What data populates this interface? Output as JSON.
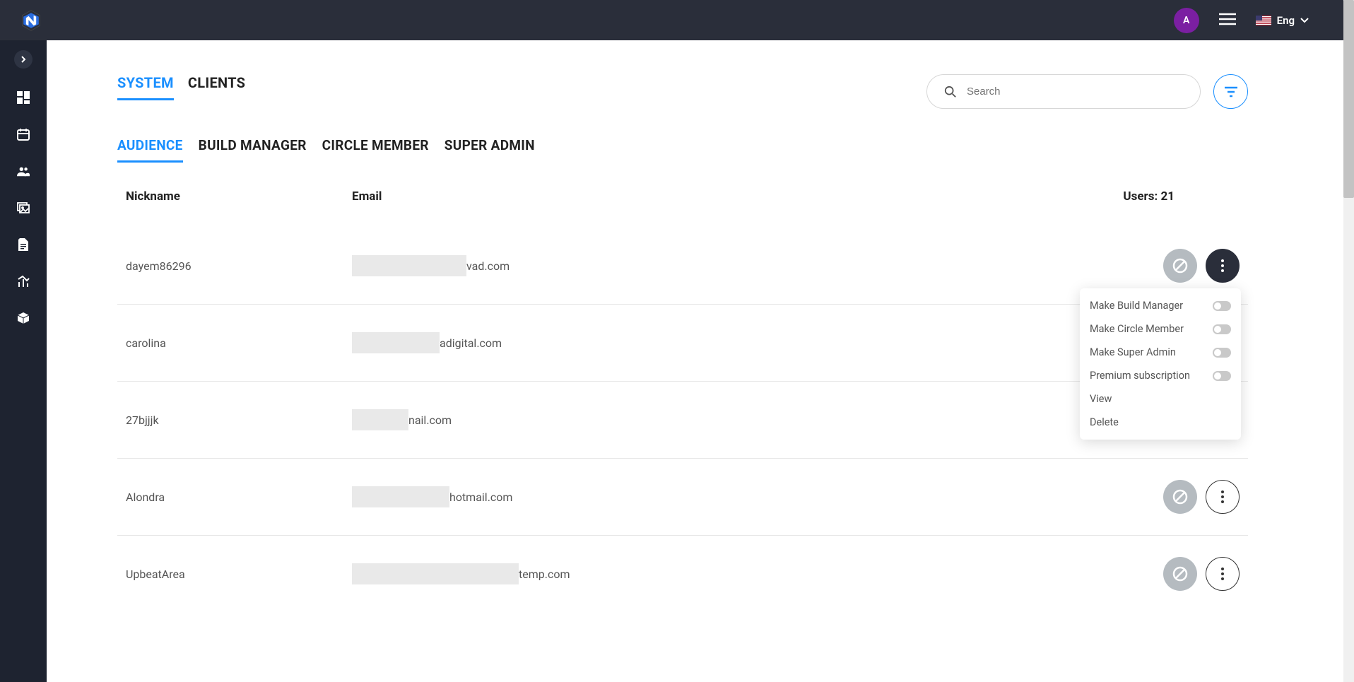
{
  "header": {
    "avatar_initial": "A",
    "language": "Eng"
  },
  "tabs": {
    "primary": [
      {
        "label": "SYSTEM",
        "active": true
      },
      {
        "label": "CLIENTS",
        "active": false
      }
    ],
    "secondary": [
      {
        "label": "AUDIENCE",
        "active": true
      },
      {
        "label": "BUILD MANAGER",
        "active": false
      },
      {
        "label": "CIRCLE MEMBER",
        "active": false
      },
      {
        "label": "SUPER ADMIN",
        "active": false
      }
    ]
  },
  "search": {
    "placeholder": "Search"
  },
  "table": {
    "col_nickname": "Nickname",
    "col_email": "Email",
    "users_label": "Users: 21"
  },
  "users": [
    {
      "nickname": "dayem86296",
      "email_suffix": "vad.com",
      "redact_w": 162,
      "menu_open": true
    },
    {
      "nickname": "carolina",
      "email_suffix": "adigital.com",
      "redact_w": 124,
      "menu_open": false
    },
    {
      "nickname": "27bjjjk",
      "email_suffix": "nail.com",
      "redact_w": 80,
      "menu_open": false
    },
    {
      "nickname": "Alondra",
      "email_suffix": "hotmail.com",
      "redact_w": 138,
      "menu_open": false
    },
    {
      "nickname": "UpbeatArea",
      "email_suffix": "temp.com",
      "redact_w": 236,
      "menu_open": false
    }
  ],
  "menu": {
    "make_build_manager": "Make Build Manager",
    "make_circle_member": "Make Circle Member",
    "make_super_admin": "Make Super Admin",
    "premium": "Premium subscription",
    "view": "View",
    "delete": "Delete"
  }
}
